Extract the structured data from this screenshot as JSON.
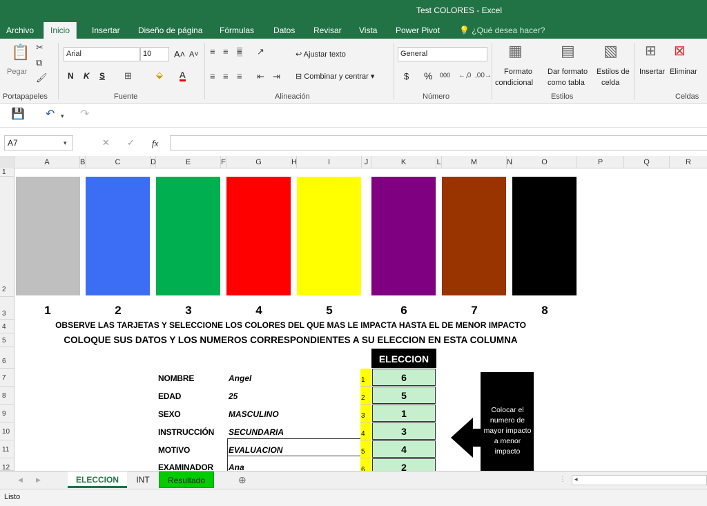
{
  "window": {
    "title": "Test COLORES - Excel"
  },
  "ribbon_tabs": [
    "Archivo",
    "Inicio",
    "Insertar",
    "Diseño de página",
    "Fórmulas",
    "Datos",
    "Revisar",
    "Vista",
    "Power Pivot"
  ],
  "tell_me": "¿Qué desea hacer?",
  "ribbon": {
    "paste": "Pegar",
    "clipboard": "Portapapeles",
    "font_name": "Arial",
    "font_size": "10",
    "bold": "N",
    "italic": "K",
    "underline": "S",
    "font_group": "Fuente",
    "wrap_text": "Ajustar texto",
    "merge_center": "Combinar y centrar",
    "alignment_group": "Alineación",
    "number_format": "General",
    "percent": "%",
    "thousands": "000",
    "currency": "$",
    "number_group": "Número",
    "cond_format_1": "Formato",
    "cond_format_2": "condicional",
    "table_format_1": "Dar formato",
    "table_format_2": "como tabla",
    "cell_styles_1": "Estilos de",
    "cell_styles_2": "celda",
    "styles_group": "Estilos",
    "insert": "Insertar",
    "delete": "Eliminar",
    "cells_group": "Celdas"
  },
  "formula_bar": {
    "name_box": "A7",
    "fx": "fx",
    "formula": ""
  },
  "columns": [
    "A",
    "B",
    "C",
    "D",
    "E",
    "F",
    "G",
    "H",
    "I",
    "J",
    "K",
    "L",
    "M",
    "N",
    "O",
    "P",
    "Q",
    "R"
  ],
  "rows": [
    "1",
    "2",
    "3",
    "4",
    "5",
    "6",
    "7",
    "8",
    "9",
    "10",
    "11",
    "12"
  ],
  "colors": [
    "#bfbfbf",
    "#3c6ef5",
    "#00b050",
    "#ff0000",
    "#ffff00",
    "#7f0080",
    "#993300",
    "#000000"
  ],
  "card_numbers": [
    "1",
    "2",
    "3",
    "4",
    "5",
    "6",
    "7",
    "8"
  ],
  "instruction_1": "OBSERVE LAS TARJETAS Y SELECCIONE LOS COLORES DEL QUE MAS LE IMPACTA HASTA EL DE MENOR IMPACTO",
  "instruction_2": "COLOQUE SUS DATOS Y LOS NUMEROS CORRESPONDIENTES A SU ELECCION EN ESTA COLUMNA",
  "fields": [
    {
      "label": "NOMBRE",
      "value": "Angel"
    },
    {
      "label": "EDAD",
      "value": "25"
    },
    {
      "label": "SEXO",
      "value": "MASCULINO"
    },
    {
      "label": "INSTRUCCIÓN",
      "value": "SECUNDARIA"
    },
    {
      "label": "MOTIVO",
      "value": "EVALUACION"
    },
    {
      "label": "EXAMINADOR",
      "value": "Ana"
    }
  ],
  "eleccion_header": "ELECCION",
  "positions": [
    "1",
    "2",
    "3",
    "4",
    "5",
    "6"
  ],
  "eleccion_values": [
    "6",
    "5",
    "1",
    "3",
    "4",
    "2"
  ],
  "callout_text": "Colocar el numero de mayor impacto a menor impacto",
  "sheets": [
    "ELECCION",
    "INT",
    "Resultado"
  ],
  "status": "Listo"
}
